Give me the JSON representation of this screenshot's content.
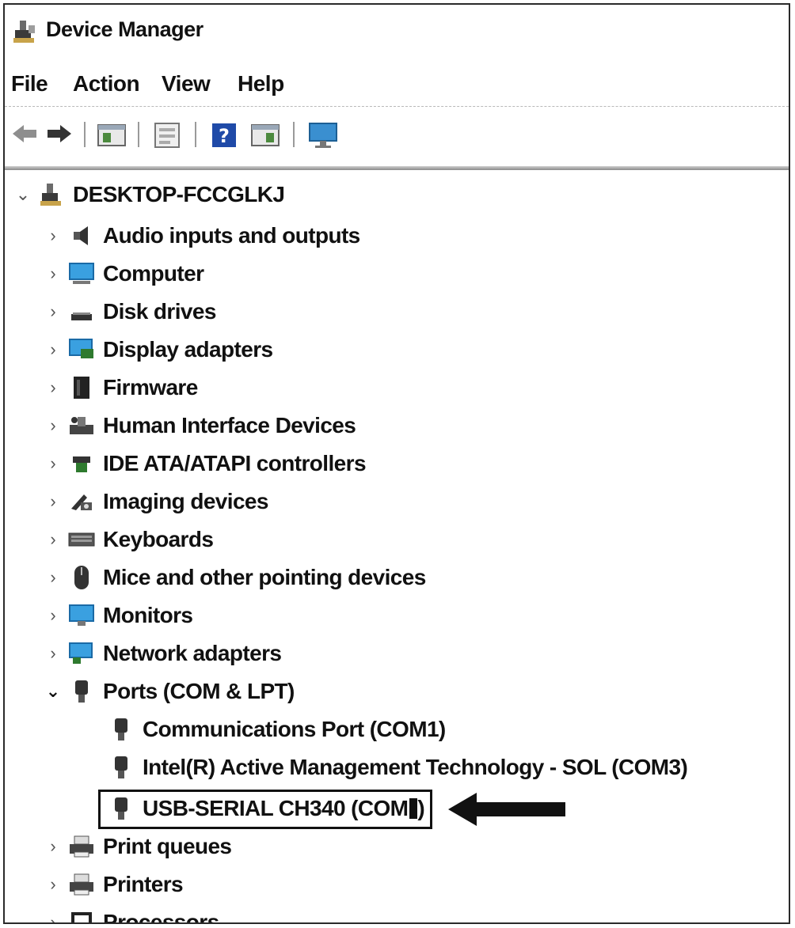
{
  "window": {
    "title": "Device Manager",
    "icon": "device-manager-icon"
  },
  "menu": [
    "File",
    "Action",
    "View",
    "Help"
  ],
  "toolbar": {
    "buttons": [
      "back-arrow-icon",
      "forward-arrow-icon",
      "show-hide-console-tree-icon",
      "properties-icon",
      "help-icon",
      "update-driver-icon",
      "monitor-icon"
    ]
  },
  "tree": {
    "root": {
      "label": "DESKTOP-FCCGLKJ",
      "expanded": true
    },
    "categories": [
      {
        "label": "Audio inputs and outputs",
        "icon": "speaker-icon",
        "expanded": false
      },
      {
        "label": "Computer",
        "icon": "computer-icon",
        "expanded": false
      },
      {
        "label": "Disk drives",
        "icon": "disk-drive-icon",
        "expanded": false
      },
      {
        "label": "Display adapters",
        "icon": "display-adapter-icon",
        "expanded": false
      },
      {
        "label": "Firmware",
        "icon": "firmware-icon",
        "expanded": false
      },
      {
        "label": "Human Interface Devices",
        "icon": "hid-icon",
        "expanded": false
      },
      {
        "label": "IDE ATA/ATAPI controllers",
        "icon": "ide-controller-icon",
        "expanded": false
      },
      {
        "label": "Imaging devices",
        "icon": "camera-icon",
        "expanded": false
      },
      {
        "label": "Keyboards",
        "icon": "keyboard-icon",
        "expanded": false
      },
      {
        "label": "Mice and other pointing devices",
        "icon": "mouse-icon",
        "expanded": false
      },
      {
        "label": "Monitors",
        "icon": "monitor-icon",
        "expanded": false
      },
      {
        "label": "Network adapters",
        "icon": "network-adapter-icon",
        "expanded": false
      },
      {
        "label": "Ports (COM & LPT)",
        "icon": "port-icon",
        "expanded": true
      },
      {
        "label": "Print queues",
        "icon": "printer-icon",
        "expanded": false
      },
      {
        "label": "Printers",
        "icon": "printer-icon",
        "expanded": false
      },
      {
        "label": "Processors",
        "icon": "processor-icon",
        "expanded": false
      }
    ],
    "ports_children": [
      {
        "label": "Communications Port (COM1)",
        "icon": "port-icon"
      },
      {
        "label": "Intel(R) Active Management Technology - SOL (COM3)",
        "icon": "port-icon"
      },
      {
        "label": "USB-SERIAL CH340 (COM",
        "icon": "port-icon",
        "highlighted": true
      }
    ]
  },
  "annotation": {
    "type": "arrow pointing left",
    "color": "#111111"
  }
}
